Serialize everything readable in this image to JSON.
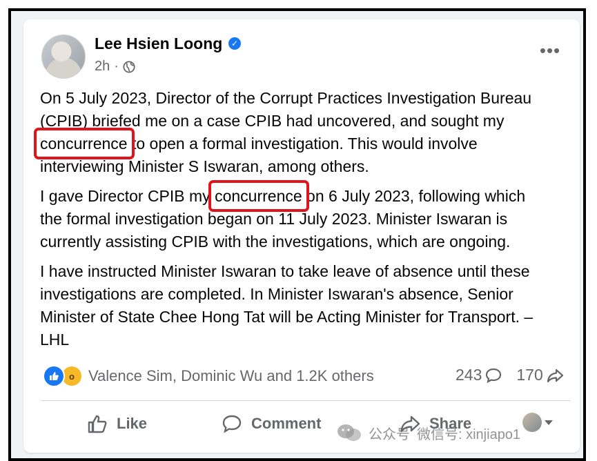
{
  "post": {
    "author": "Lee Hsien Loong",
    "time": "2h",
    "separator": "·",
    "paragraphs": [
      {
        "lines": [
          [
            "On 5 July 2023, Director of the Corrupt Practices Investigation Bureau"
          ],
          [
            "(CPIB) briefed me on a case CPIB had uncovered, and sought my"
          ],
          [
            "",
            "concurrence",
            " to open a formal investigation. This would involve"
          ],
          [
            "interviewing Minister S Iswaran, among others."
          ]
        ]
      },
      {
        "lines": [
          [
            "I gave Director CPIB my ",
            "concurrence",
            " on 6 July 2023, following which"
          ],
          [
            "the formal investigation began on 11 July 2023. Minister Iswaran is"
          ],
          [
            "currently assisting CPIB with the investigations, which are ongoing."
          ]
        ]
      },
      {
        "lines": [
          [
            "I have instructed Minister Iswaran to take leave of absence until these"
          ],
          [
            "investigations are completed. In Minister Iswaran's absence, Senior"
          ],
          [
            "Minister of State Chee Hong Tat will be Acting Minister for Transport. –"
          ],
          [
            "LHL"
          ]
        ]
      }
    ],
    "highlight_color": "#e0141b"
  },
  "reactions": {
    "names": "Valence Sim, Dominic Wu and 1.2K others",
    "comments_count": "243",
    "shares_count": "170",
    "icons": [
      "like-icon",
      "wow-icon"
    ]
  },
  "actions": {
    "like_label": "Like",
    "comment_label": "Comment",
    "share_label": "Share"
  },
  "watermark": {
    "text": "公众号",
    "handle": "微信号: xinjiapo1"
  },
  "colors": {
    "brand_blue": "#1877f2",
    "secondary_text": "#65676b",
    "primary_text": "#050505"
  }
}
